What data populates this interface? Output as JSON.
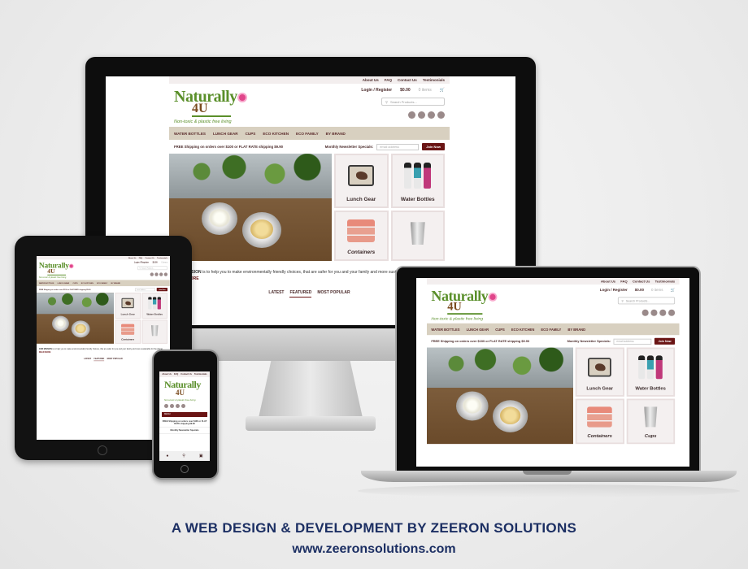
{
  "site": {
    "top_links": [
      "About Us",
      "FAQ",
      "Contact Us",
      "Testimonials"
    ],
    "logo_line1": "Naturally",
    "logo_line2": "4U",
    "tagline": "Non-toxic & plastic free living",
    "login": "Login / Register",
    "cart_total": "$0.00",
    "cart_items": "0 items",
    "search_placeholder": "Search Products...",
    "nav": [
      "WATER BOTTLES",
      "LUNCH GEAR",
      "CUPS",
      "ECO KITCHEN",
      "ECO FAMILY",
      "BY BRAND"
    ],
    "promo": "FREE Shipping on orders over $100 or FLAT RATE shipping $9.90",
    "newsletter_label": "Monthly Newsletter Specials:",
    "email_placeholder": "email address",
    "join_button": "Join Now",
    "tiles": [
      "Lunch Gear",
      "Water Bottles",
      "Containers",
      "Cups"
    ],
    "mission_title": "OUR MISSION",
    "mission_text": "is to help you to make environmentally friendly choices, that are safer for you and your family and more sustainable for the planet.",
    "read_more": "READ MORE",
    "tabs": [
      "LATEST",
      "FEATURED",
      "MOST POPULAR"
    ],
    "tab_active": "FEATURED"
  },
  "phone": {
    "menu_label": "MENU",
    "newsletter": "Monthly Newsletter Specials"
  },
  "credit": {
    "line1": "A WEB DESIGN & DEVELOPMENT BY ZEERON SOLUTIONS",
    "line2": "www.zeeronsolutions.com"
  },
  "colors": {
    "accent": "#6a1414",
    "logo_green": "#5a8f2a",
    "nav_bg": "#d8d0c0",
    "credit_text": "#1c2f63"
  }
}
